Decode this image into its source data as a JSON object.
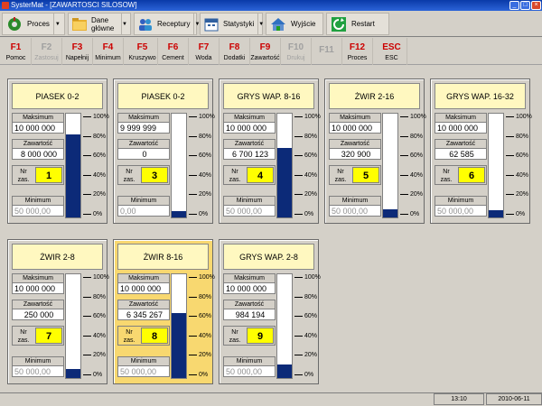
{
  "window": {
    "title": "SysterMat - [ZAWARTOSCI SILOSOW]"
  },
  "toolbar": [
    {
      "label": "Proces",
      "icon": "process-icon",
      "dropdown": true
    },
    {
      "label": "Dane główne",
      "icon": "folder-icon",
      "dropdown": true
    },
    {
      "label": "Receptury",
      "icon": "people-icon",
      "dropdown": true
    },
    {
      "label": "Statystyki",
      "icon": "calendar-icon",
      "dropdown": true
    },
    {
      "label": "Wyjście",
      "icon": "home-exit-icon",
      "dropdown": false
    },
    {
      "label": "Restart",
      "icon": "restart-icon",
      "dropdown": false
    }
  ],
  "fkeys": [
    {
      "key": "F1",
      "label": "Pomoc",
      "enabled": true
    },
    {
      "key": "F2",
      "label": "Zastosuj",
      "enabled": false
    },
    {
      "key": "F3",
      "label": "Napełnij",
      "enabled": true
    },
    {
      "key": "F4",
      "label": "Minimum",
      "enabled": true
    },
    {
      "key": "F5",
      "label": "Kruszywo",
      "enabled": true
    },
    {
      "key": "F6",
      "label": "Cement",
      "enabled": true
    },
    {
      "key": "F7",
      "label": "Woda",
      "enabled": true
    },
    {
      "key": "F8",
      "label": "Dodatki",
      "enabled": true
    },
    {
      "key": "F9",
      "label": "Zawartość",
      "enabled": true
    },
    {
      "key": "F10",
      "label": "Drukuj",
      "enabled": false
    },
    {
      "key": "F11",
      "label": "",
      "enabled": false
    },
    {
      "key": "F12",
      "label": "Proces",
      "enabled": true
    },
    {
      "key": "ESC",
      "label": "ESC",
      "enabled": true
    }
  ],
  "labels": {
    "maksimum": "Maksimum",
    "zawartosc": "Zawartość",
    "nr_line1": "Nr",
    "nr_line2": "zas.",
    "minimum": "Minimum"
  },
  "scale": [
    "100%",
    "80%",
    "60%",
    "40%",
    "20%",
    "0%"
  ],
  "silos": [
    {
      "name": "PIASEK 0-2",
      "maksimum": "10 000 000",
      "zawartosc": "8 000 000",
      "nr": "1",
      "minimum": "50 000,00",
      "fill_fraction": 0.8,
      "active": false
    },
    {
      "name": "PIASEK 0-2",
      "maksimum": "9 999 999",
      "zawartosc": "0",
      "nr": "3",
      "minimum": "0,00",
      "fill_fraction": 0.06,
      "active": false
    },
    {
      "name": "GRYS WAP. 8-16",
      "maksimum": "10 000 000",
      "zawartosc": "6 700 123",
      "nr": "4",
      "minimum": "50 000,00",
      "fill_fraction": 0.67,
      "active": false
    },
    {
      "name": "ŻWIR 2-16",
      "maksimum": "10 000 000",
      "zawartosc": "320 900",
      "nr": "5",
      "minimum": "50 000,00",
      "fill_fraction": 0.08,
      "active": false
    },
    {
      "name": "GRYS WAP.  16-32",
      "maksimum": "10 000 000",
      "zawartosc": "62 585",
      "nr": "6",
      "minimum": "50 000,00",
      "fill_fraction": 0.07,
      "active": false
    },
    {
      "name": "ŻWIR 2-8",
      "maksimum": "10 000 000",
      "zawartosc": "250 000",
      "nr": "7",
      "minimum": "50 000,00",
      "fill_fraction": 0.09,
      "active": false
    },
    {
      "name": "ŻWIR 8-16",
      "maksimum": "10 000 000",
      "zawartosc": "6 345 267",
      "nr": "8",
      "minimum": "50 000,00",
      "fill_fraction": 0.63,
      "active": true
    },
    {
      "name": "GRYS WAP. 2-8",
      "maksimum": "10 000 000",
      "zawartosc": "984 194",
      "nr": "9",
      "minimum": "50 000,00",
      "fill_fraction": 0.13,
      "active": false
    }
  ],
  "status": {
    "time": "13:10",
    "date": "2010-06-11"
  }
}
